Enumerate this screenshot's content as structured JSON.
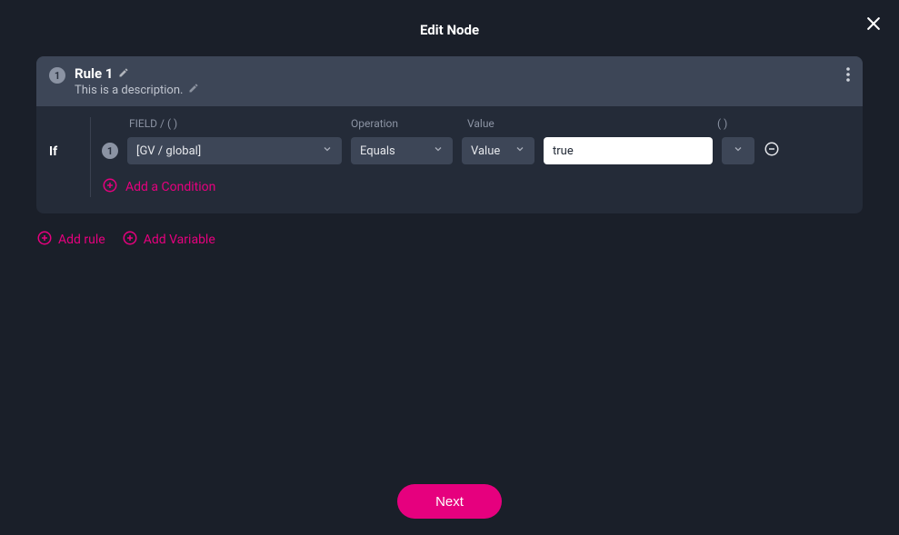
{
  "modal": {
    "title": "Edit Node"
  },
  "rule": {
    "badge": "1",
    "title": "Rule 1",
    "description": "This is a description.",
    "if_label": "If",
    "headers": {
      "field": "FIELD / ( )",
      "operation": "Operation",
      "value": "Value",
      "paren": "( )"
    },
    "condition": {
      "index": "1",
      "field": "[GV / global]",
      "operation": "Equals",
      "value_type": "Value",
      "value": "true"
    },
    "add_condition": "Add a Condition"
  },
  "actions": {
    "add_rule": "Add rule",
    "add_variable": "Add Variable",
    "next": "Next"
  }
}
